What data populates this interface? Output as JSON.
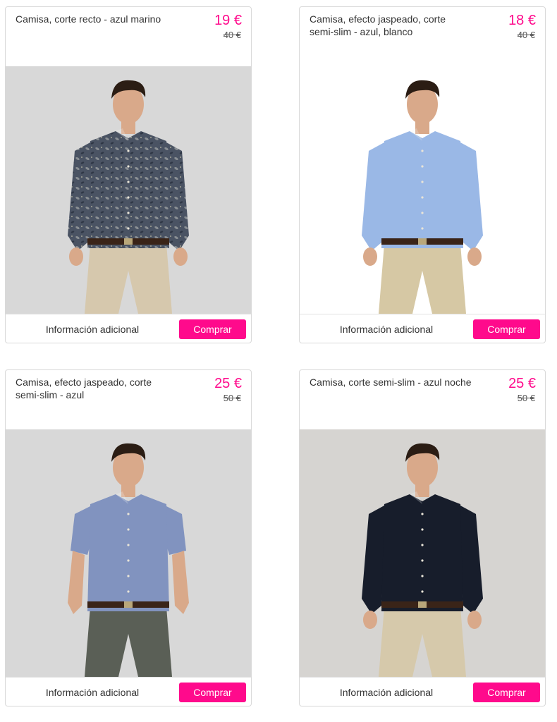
{
  "colors": {
    "accent": "#ff0a8c",
    "card_border": "#d9d9d9",
    "text": "#333333"
  },
  "products": [
    {
      "title": "Camisa, corte recto - azul marino",
      "price": "19 €",
      "old_price": "40 €",
      "info_label": "Información adicional",
      "buy_label": "Comprar",
      "image": {
        "bg_color": "#d8d8d8",
        "shirt_color": "#4a5363",
        "shirt_pattern": "paisley",
        "sleeves": "long",
        "pants_color": "#d6c8ad"
      }
    },
    {
      "title": "Camisa, efecto jaspeado, corte semi-slim - azul, blanco",
      "price": "18 €",
      "old_price": "40 €",
      "info_label": "Información adicional",
      "buy_label": "Comprar",
      "image": {
        "bg_color": "#ffffff",
        "shirt_color": "#9ab8e6",
        "shirt_pattern": "plain",
        "sleeves": "long",
        "pants_color": "#d6c8a4"
      }
    },
    {
      "title": "Camisa, efecto jaspeado, corte semi-slim - azul",
      "price": "25 €",
      "old_price": "50 €",
      "info_label": "Información adicional",
      "buy_label": "Comprar",
      "image": {
        "bg_color": "#d8d8d8",
        "shirt_color": "#8193bf",
        "shirt_pattern": "plain",
        "sleeves": "short",
        "pants_color": "#5a5f56"
      }
    },
    {
      "title": "Camisa, corte semi-slim - azul noche",
      "price": "25 €",
      "old_price": "50 €",
      "info_label": "Información adicional",
      "buy_label": "Comprar",
      "image": {
        "bg_color": "#d6d4d1",
        "shirt_color": "#171d2b",
        "shirt_pattern": "plain",
        "sleeves": "long",
        "pants_color": "#d6c9ab"
      }
    }
  ]
}
